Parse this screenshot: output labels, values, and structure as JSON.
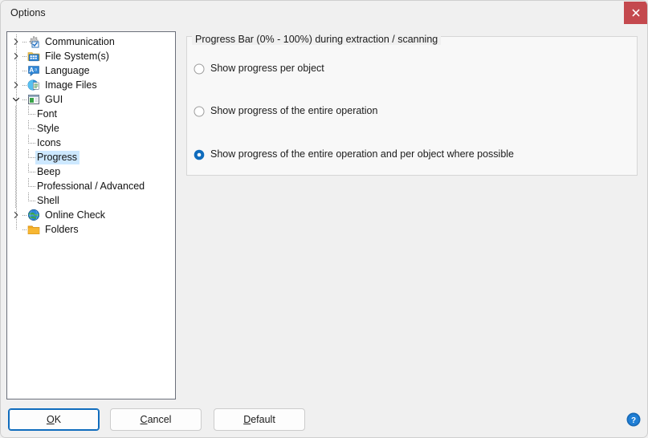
{
  "window": {
    "title": "Options",
    "close_icon": "close-icon",
    "close_color": "#c4494e"
  },
  "tree": {
    "selected": "Progress",
    "items": [
      {
        "label": "Communication",
        "level": 0,
        "expander": "collapsed",
        "icon": "settings-gear-checkbox-icon"
      },
      {
        "label": "File System(s)",
        "level": 0,
        "expander": "collapsed",
        "icon": "folder-grid-icon"
      },
      {
        "label": "Language",
        "level": 0,
        "expander": "none",
        "icon": "language-bubble-icon"
      },
      {
        "label": "Image Files",
        "level": 0,
        "expander": "collapsed",
        "icon": "image-files-icon"
      },
      {
        "label": "GUI",
        "level": 0,
        "expander": "expanded",
        "icon": "window-gui-icon"
      },
      {
        "label": "Font",
        "level": 1,
        "expander": "none",
        "icon": "none"
      },
      {
        "label": "Style",
        "level": 1,
        "expander": "none",
        "icon": "none"
      },
      {
        "label": "Icons",
        "level": 1,
        "expander": "none",
        "icon": "none"
      },
      {
        "label": "Progress",
        "level": 1,
        "expander": "none",
        "icon": "none"
      },
      {
        "label": "Beep",
        "level": 1,
        "expander": "none",
        "icon": "none"
      },
      {
        "label": "Professional / Advanced",
        "level": 1,
        "expander": "none",
        "icon": "none"
      },
      {
        "label": "Shell",
        "level": 1,
        "expander": "none",
        "icon": "none"
      },
      {
        "label": "Online Check",
        "level": 0,
        "expander": "collapsed",
        "icon": "globe-icon"
      },
      {
        "label": "Folders",
        "level": 0,
        "expander": "none",
        "icon": "folder-icon"
      }
    ]
  },
  "groupbox": {
    "title": "Progress Bar (0% - 100%) during extraction / scanning",
    "options": [
      {
        "label": "Show progress per object",
        "selected": false
      },
      {
        "label": "Show progress of the entire operation",
        "selected": false
      },
      {
        "label": "Show progress of the entire operation and per object where possible",
        "selected": true
      }
    ]
  },
  "footer": {
    "ok": {
      "accel": "O",
      "rest": "K"
    },
    "cancel": {
      "accel": "C",
      "rest": "ancel"
    },
    "default": {
      "accel": "D",
      "rest": "efault"
    },
    "help_icon": "help-question-icon"
  },
  "colors": {
    "accent": "#0f6cbd",
    "selection": "#cde8ff",
    "close_red": "#c4494e",
    "window_bg": "#f0f0f0",
    "panel_bg": "#f8f8f8"
  }
}
